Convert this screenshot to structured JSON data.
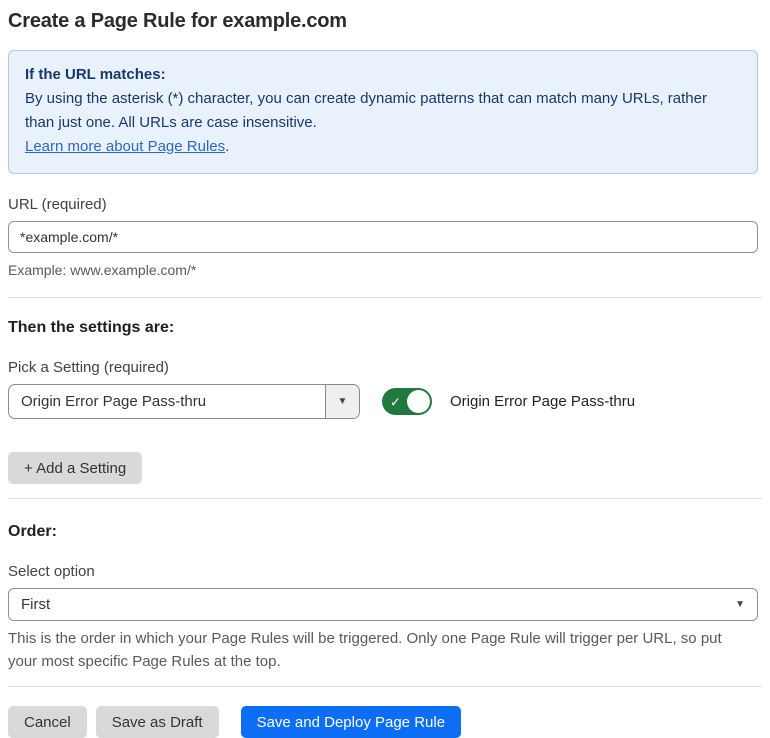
{
  "page": {
    "title": "Create a Page Rule for example.com"
  },
  "info_box": {
    "heading": "If the URL matches:",
    "body": "By using the asterisk (*) character, you can create dynamic patterns that can match many URLs, rather than just one. All URLs are case insensitive.",
    "link_label": "Learn more about Page Rules",
    "link_suffix": "."
  },
  "url_field": {
    "label": "URL (required)",
    "value": "*example.com/*",
    "helper": "Example: www.example.com/*"
  },
  "settings_section": {
    "heading": "Then the settings are:",
    "picker_label": "Pick a Setting (required)",
    "picker_value": "Origin Error Page Pass-thru",
    "toggle_state": "on",
    "toggle_label": "Origin Error Page Pass-thru",
    "add_setting_label": "+ Add a Setting"
  },
  "order_section": {
    "heading": "Order:",
    "select_label": "Select option",
    "select_value": "First",
    "helper": "This is the order in which your Page Rules will be triggered. Only one Page Rule will trigger per URL, so put your most specific Page Rules at the top."
  },
  "footer": {
    "cancel_label": "Cancel",
    "save_draft_label": "Save as Draft",
    "save_deploy_label": "Save and Deploy Page Rule"
  },
  "icons": {
    "dropdown_arrow": "▼",
    "toggle_check": "✓"
  },
  "colors": {
    "accent_blue": "#0d6ef5",
    "info_background": "#e9f2fc",
    "info_border": "#a9c9ea",
    "info_text": "#173968",
    "link_blue": "#2c67c8",
    "toggle_green": "#21793f",
    "gray_button": "#d9d9d9"
  }
}
